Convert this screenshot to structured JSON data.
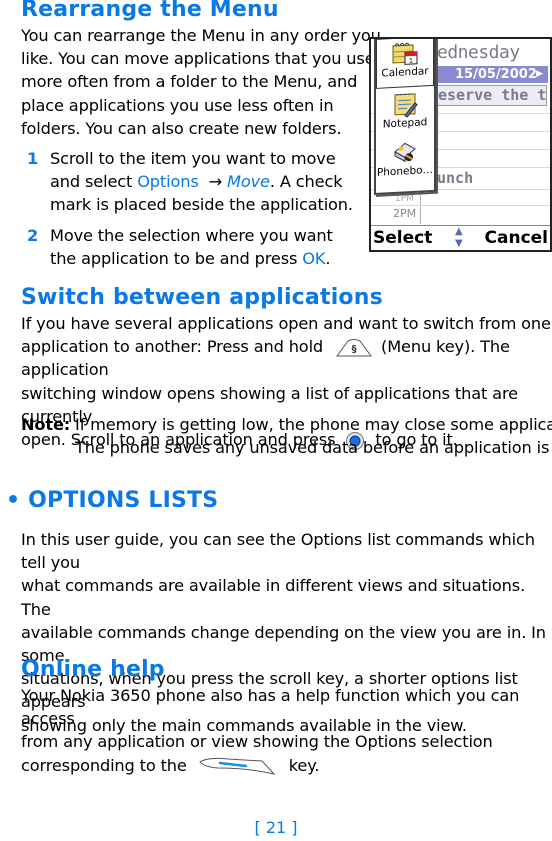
{
  "sections": {
    "rearrange": {
      "title": "Rearrange the Menu",
      "body": "You can rearrange the Menu in any order you like. You can move applications that you use more often from a folder to the Menu, and place applications you use less often in folders. You can also create new folders.",
      "body_lines": [
        "You can rearrange the Menu in any order you",
        "like. You can move applications that you use",
        "more often from a folder to the Menu, and",
        "place applications you use less often in",
        "folders. You can also create new folders."
      ],
      "steps": [
        {
          "number": "1",
          "pre": "Scroll to the item you want to move and select ",
          "menu": "Options",
          "arrow": "→",
          "command": "Move",
          "post": ".  A check mark is placed beside the application."
        },
        {
          "number": "2",
          "pre": "Move the selection where you want the application to be and press ",
          "key": "OK",
          "post": "."
        }
      ]
    },
    "switch": {
      "title": "Switch between applications",
      "lines": [
        "If you have several applications open and want to switch from one",
        "application to another: Press and hold",
        "(Menu key). The application",
        "switching window opens showing a list of applications that are currently",
        "open. Scroll to an application and press",
        "to go to it."
      ],
      "note_label": "Note:",
      "note_lines": [
        "If memory is getting low, the phone may close some applications.",
        "The phone saves any unsaved data before an application is closed."
      ]
    },
    "options_lists": {
      "bullet": "•",
      "title": "OPTIONS LISTS",
      "lines": [
        "In this user guide, you can see the Options list commands which tell you",
        "what commands are available in different views and situations. The",
        "available commands change depending on the view you are in. In some",
        "situations, when you press the scroll key, a shorter options list appears",
        "showing only the main commands available in the view."
      ]
    },
    "online_help": {
      "title": "Online help",
      "lines": [
        "Your Nokia 3650 phone also has a help function which you can access",
        "from any application or view showing the Options selection",
        "corresponding to the",
        "key."
      ]
    }
  },
  "phone_screen": {
    "day": "ednesday",
    "date": "15/05/2002",
    "entry": "eserve the ti…",
    "lunch": "unch",
    "time_partial": "1PM",
    "time": "2PM",
    "menu_items": [
      {
        "label": "Calendar",
        "icon": "calendar-icon",
        "selected": true
      },
      {
        "label": "Notepad",
        "icon": "notepad-icon",
        "selected": false
      },
      {
        "label": "Phonebo…",
        "icon": "phonebook-icon",
        "selected": false
      }
    ],
    "softkey_left": "Select",
    "softkey_right": "Cancel"
  },
  "page_number": "[ 21 ]",
  "colors": {
    "accent": "#0a79e3",
    "date_bar": "#8a8ad0"
  }
}
